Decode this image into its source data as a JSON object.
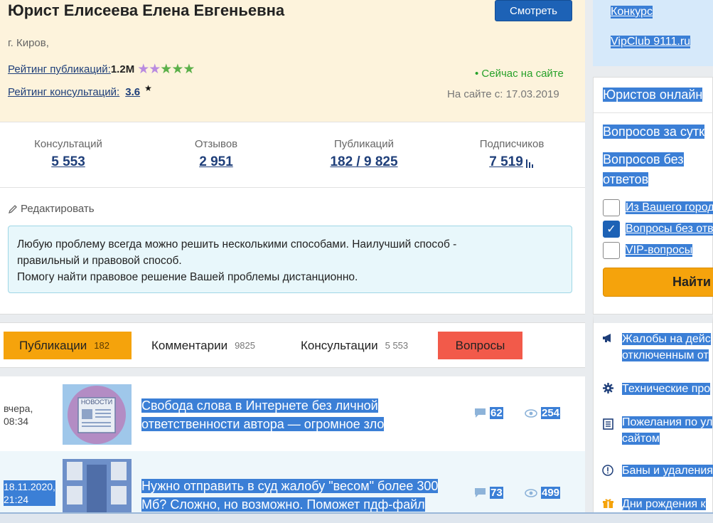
{
  "profile": {
    "name": "Юрист Елисеева Елена Евгеньевна",
    "watch_button": "Смотреть",
    "city": "г. Киров,",
    "pub_rating_label": "Рейтинг публикаций:",
    "pub_rating_value": "1.2M",
    "pub_rating_stars": 5,
    "consult_rating_label": "Рейтинг консультаций:",
    "consult_rating_value": "3.6",
    "consult_star": "★",
    "online_status": "• Сейчас на сайте",
    "on_site_since": "На сайте с: 17.03.2019"
  },
  "stats": [
    {
      "label": "Консультаций",
      "value": "5 553"
    },
    {
      "label": "Отзывов",
      "value": "2 951"
    },
    {
      "label": "Публикаций",
      "value": "182 / 9 825"
    },
    {
      "label": "Подписчиков",
      "value": "7 519"
    }
  ],
  "about": {
    "edit_label": "Редактировать",
    "line1": "Любую проблему всегда можно решить несколькими способами. Наилучший способ -",
    "line2": "правильный и правовой способ.",
    "line3": "Помогу найти правовое решение Вашей проблемы дистанционно."
  },
  "tabs": [
    {
      "label": "Публикации",
      "count": "182"
    },
    {
      "label": "Комментарии",
      "count": "9825"
    },
    {
      "label": "Консультации",
      "count": "5 553"
    },
    {
      "label": "Вопросы",
      "count": ""
    }
  ],
  "feed": [
    {
      "date": "вчера,",
      "time": "08:34",
      "thumb_text": "НОВОСТИ",
      "title_line1": "Свобода слова в Интернете без личной",
      "title_line2": "ответственности автора — огромное зло",
      "comments": "62",
      "views": "254"
    },
    {
      "date": "18.11.2020,",
      "time": "21:24",
      "title_line1": "Нужно отправить в суд жалобу \"весом\" более 300",
      "title_line2": "Мб? Сложно, но возможно. Поможет пдф-файл",
      "comments": "73",
      "views": "499"
    }
  ],
  "sidebar": {
    "links": [
      "Конкурс",
      "VipClub 9111.ru"
    ],
    "online_header": "Юристов онлайн",
    "questions_day": "Вопросов за сутк",
    "no_answer_1": "Вопросов без",
    "no_answer_2": "ответов",
    "filters": [
      {
        "label": "Из Вашего город",
        "checked": false
      },
      {
        "label": "Вопросы без отв",
        "checked": true
      },
      {
        "label": "VIP-вопросы",
        "checked": false
      }
    ],
    "find_button": "Найти",
    "menu": [
      {
        "icon": "megaphone-icon",
        "line1": "Жалобы на дейс",
        "line2": "отключенным от"
      },
      {
        "icon": "gear-icon",
        "line1": "Технические про",
        "line2": ""
      },
      {
        "icon": "document-icon",
        "line1": "Пожелания по ул",
        "line2": "сайтом"
      },
      {
        "icon": "alert-icon",
        "line1": "Баны и удаления",
        "line2": ""
      },
      {
        "icon": "gift-icon",
        "line1": "Дни рождения к",
        "line2": ""
      }
    ]
  },
  "colors": {
    "accent_blue": "#1d62b6",
    "link_blue": "#1f3f7a",
    "orange": "#f5a30c",
    "red": "#f25a4a",
    "green": "#27a12a",
    "selection": "#3b7fd6"
  }
}
